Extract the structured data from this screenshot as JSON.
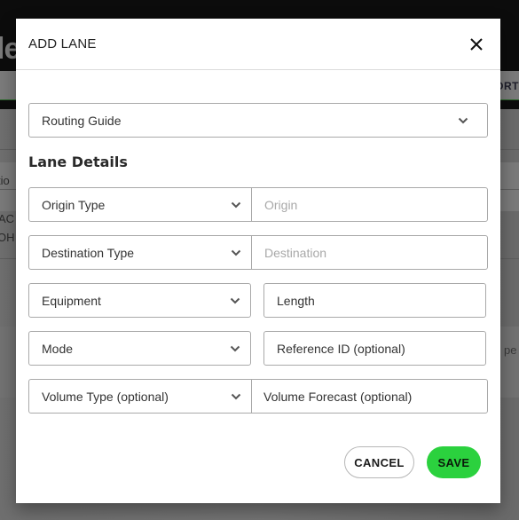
{
  "background": {
    "page_title_fragment": "le",
    "nav_text_fragment": "ORT",
    "table_header_fragment": "tio",
    "row_fragments": [
      "AC",
      "OH"
    ],
    "right_fragment": "pe"
  },
  "modal": {
    "title": "ADD LANE",
    "close_icon": "close-icon",
    "routing_guide": {
      "label": "Routing Guide",
      "icon": "chevron-down-icon"
    },
    "section_title": "Lane Details",
    "rows": [
      {
        "select": {
          "label": "Origin Type",
          "icon": "chevron-down-icon"
        },
        "input": {
          "placeholder": "Origin",
          "value": ""
        }
      },
      {
        "select": {
          "label": "Destination Type",
          "icon": "chevron-down-icon"
        },
        "input": {
          "placeholder": "Destination",
          "value": ""
        }
      },
      {
        "select": {
          "label": "Equipment",
          "icon": "chevron-down-icon"
        },
        "input": {
          "label": "Length"
        }
      },
      {
        "select": {
          "label": "Mode",
          "icon": "chevron-down-icon"
        },
        "input": {
          "label": "Reference ID (optional)"
        }
      },
      {
        "select": {
          "label": "Volume Type (optional)",
          "icon": "chevron-down-icon"
        },
        "input": {
          "label": "Volume Forecast (optional)"
        }
      }
    ],
    "buttons": {
      "cancel": "CANCEL",
      "save": "SAVE"
    },
    "colors": {
      "save_bg": "#2bd13e",
      "border": "#a9a9a9"
    }
  }
}
